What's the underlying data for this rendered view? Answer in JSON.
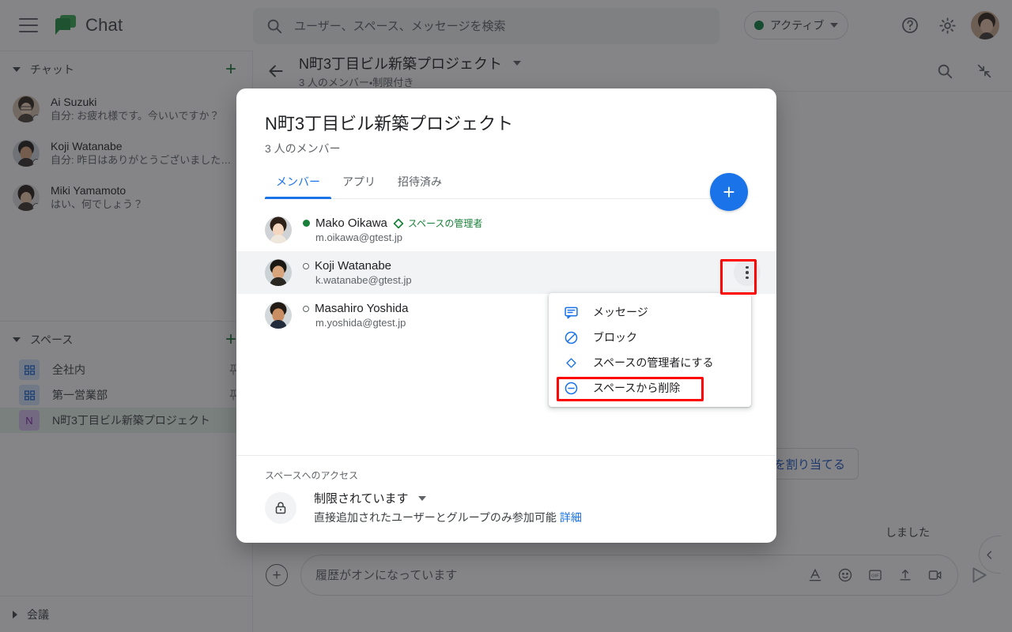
{
  "colors": {
    "accent_blue": "#1a73e8",
    "green": "#188038",
    "highlight_red": "#ff0000",
    "scrim": "rgba(32,33,36,.55)"
  },
  "topbar": {
    "menu_icon": "hamburger-icon",
    "app_title": "Chat",
    "search": {
      "placeholder": "ユーザー、スペース、メッセージを検索",
      "value": "",
      "icon": "search-icon"
    },
    "status": {
      "label": "アクティブ",
      "dot_color": "#0b8043",
      "caret": "chevron-down-icon"
    },
    "help_icon": "help-icon",
    "settings_icon": "gear-icon",
    "apps_icon": "apps-grid-icon",
    "account_avatar": "avatar"
  },
  "sidebar": {
    "chat_section": {
      "title": "チャット",
      "add_label": "+",
      "items": [
        {
          "name": "Ai Suzuki",
          "snippet": "自分: お疲れ様です。今いいですか？"
        },
        {
          "name": "Koji Watanabe",
          "snippet": "自分: 昨日はありがとうございました…"
        },
        {
          "name": "Miki Yamamoto",
          "snippet": "はい、何でしょう？"
        }
      ]
    },
    "spaces_section": {
      "title": "スペース",
      "add_label": "+",
      "items": [
        {
          "name": "全社内",
          "icon": "grid",
          "letter": "",
          "pinned": true,
          "active": false
        },
        {
          "name": "第一営業部",
          "icon": "grid",
          "letter": "",
          "pinned": true,
          "active": false
        },
        {
          "name": "N町3丁目ビル新築プロジェクト",
          "icon": "letter",
          "letter": "N",
          "pinned": false,
          "active": true
        }
      ]
    },
    "meetings_section": {
      "title": "会議"
    }
  },
  "conversation": {
    "back_icon": "back-arrow-icon",
    "title": "N町3丁目ビル新築プロジェクト",
    "title_caret": "chevron-down-icon",
    "subtitle": "3 人のメンバー・制限付き",
    "search_icon": "search-icon",
    "collapse_icon": "collapse-icon",
    "assign_button_partial": "を割り当てる",
    "status_text_partial": "しました",
    "composer": {
      "add_icon": "plus-circle-icon",
      "placeholder": "履歴がオンになっています",
      "value": "",
      "icons": [
        "format-text-icon",
        "emoji-icon",
        "gif-icon",
        "upload-icon",
        "video-icon"
      ],
      "send_icon": "send-icon"
    },
    "panel_collapse_icon": "chevron-left-icon"
  },
  "dialog": {
    "title": "N町3丁目ビル新築プロジェクト",
    "subtitle": "3 人のメンバー",
    "tabs": [
      {
        "label": "メンバー",
        "active": true
      },
      {
        "label": "アプリ",
        "active": false
      },
      {
        "label": "招待済み",
        "active": false
      }
    ],
    "add_member_fab": {
      "label": "+",
      "icon": "plus-icon"
    },
    "members": [
      {
        "name": "Mako Oikawa",
        "email": "m.oikawa@gtest.jp",
        "presence": "active",
        "badge": "スペースの管理者",
        "badge_icon": "diamond-icon",
        "hovered": false
      },
      {
        "name": "Koji Watanabe",
        "email": "k.watanabe@gtest.jp",
        "presence": "away",
        "badge": "",
        "badge_icon": "",
        "hovered": true
      },
      {
        "name": "Masahiro Yoshida",
        "email": "m.yoshida@gtest.jp",
        "presence": "away",
        "badge": "",
        "badge_icon": "",
        "hovered": false
      }
    ],
    "more_menu_icon": "more-vert-icon",
    "footer": {
      "label": "スペースへのアクセス",
      "lock_icon": "lock-icon",
      "access_title": "制限されています",
      "access_caret": "chevron-down-icon",
      "description": "直接追加されたユーザーとグループのみ参加可能",
      "link": "詳細"
    }
  },
  "context_menu": {
    "items": [
      {
        "label": "メッセージ",
        "icon": "message-icon",
        "highlighted": false
      },
      {
        "label": "ブロック",
        "icon": "block-icon",
        "highlighted": false
      },
      {
        "label": "スペースの管理者にする",
        "icon": "diamond-icon",
        "highlighted": false
      },
      {
        "label": "スペースから削除",
        "icon": "remove-circle-icon",
        "highlighted": true
      }
    ]
  }
}
